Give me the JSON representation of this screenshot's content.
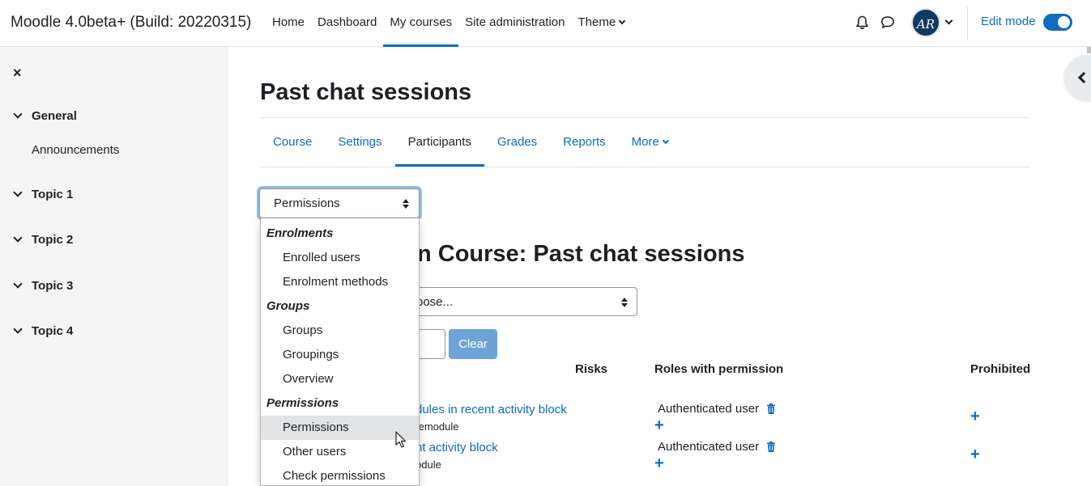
{
  "navbar": {
    "brand": "Moodle 4.0beta+ (Build: 20220315)",
    "items": [
      {
        "label": "Home"
      },
      {
        "label": "Dashboard"
      },
      {
        "label": "My courses"
      },
      {
        "label": "Site administration"
      },
      {
        "label": "Theme"
      }
    ],
    "active_item": "My courses",
    "avatar_initials": "AR",
    "edit_mode_label": "Edit mode",
    "edit_mode_on": true,
    "accent_color": "#0f6cbf"
  },
  "sidebar": {
    "close_icon": "×",
    "sections": [
      {
        "label": "General",
        "items": [
          "Announcements"
        ]
      },
      {
        "label": "Topic 1",
        "items": []
      },
      {
        "label": "Topic 2",
        "items": []
      },
      {
        "label": "Topic 3",
        "items": []
      },
      {
        "label": "Topic 4",
        "items": []
      }
    ]
  },
  "main": {
    "title": "Past chat sessions",
    "tabs": [
      {
        "label": "Course"
      },
      {
        "label": "Settings"
      },
      {
        "label": "Participants"
      },
      {
        "label": "Grades"
      },
      {
        "label": "Reports"
      },
      {
        "label": "More"
      }
    ],
    "active_tab": "Participants",
    "page_select_value": "Permissions",
    "heading_visible_part": "n Course: Past chat sessions",
    "role_select_visible_part": "oose...",
    "clear_button": "Clear",
    "table": {
      "headers": {
        "risks": "Risks",
        "roles": "Roles with permission",
        "prohibited": "Prohibited"
      },
      "rows": [
        {
          "capability_visible": "dules in recent activity block",
          "code_visible": "temodule",
          "role": "Authenticated user"
        },
        {
          "capability_visible": "nt activity block",
          "code_visible": "odule",
          "role": "Authenticated user"
        }
      ]
    }
  },
  "dropdown": {
    "groups": [
      {
        "label": "Enrolments",
        "items": [
          "Enrolled users",
          "Enrolment methods"
        ]
      },
      {
        "label": "Groups",
        "items": [
          "Groups",
          "Groupings",
          "Overview"
        ]
      },
      {
        "label": "Permissions",
        "items": [
          "Permissions",
          "Other users",
          "Check permissions"
        ]
      }
    ],
    "hovered_item": "Permissions"
  }
}
